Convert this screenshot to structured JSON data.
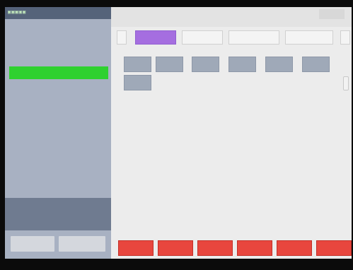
{
  "app": {
    "logo": "▣▣▣▣▣",
    "subtitle": "",
    "right_title": "",
    "header_button": ""
  },
  "ticket": {
    "items": [
      {
        "qty": "",
        "name": "",
        "price": ""
      },
      {
        "qty": "",
        "name": "",
        "price": ""
      },
      {
        "qty": "",
        "name": "",
        "price": ""
      },
      {
        "qty": "",
        "name": "",
        "price": ""
      }
    ]
  },
  "summary": {
    "rows": [
      {
        "label": "",
        "value": ""
      },
      {
        "label": "",
        "value": ""
      },
      {
        "label": "",
        "value": ""
      }
    ],
    "total": {
      "label": "",
      "value": ""
    }
  },
  "left_buttons": [
    "",
    ""
  ],
  "tabs": {
    "prev": "",
    "next": "",
    "items": [
      "",
      "",
      "",
      ""
    ],
    "active_index": 0
  },
  "products": [
    {
      "name": "",
      "price": ""
    },
    {
      "name": "",
      "price": ""
    },
    {
      "name": "",
      "price": ""
    },
    {
      "name": "",
      "price": ""
    },
    {
      "name": "",
      "price": ""
    },
    {
      "name": "",
      "price": ""
    },
    {
      "name": "",
      "price": ""
    }
  ],
  "function_buttons": [
    "",
    "",
    "",
    "",
    "",
    ""
  ],
  "colors": {
    "selected_row": "#2fd12f",
    "active_tab": "#a56ee0",
    "function_button": "#e8463e",
    "product_tile": "#9fa9b8"
  }
}
